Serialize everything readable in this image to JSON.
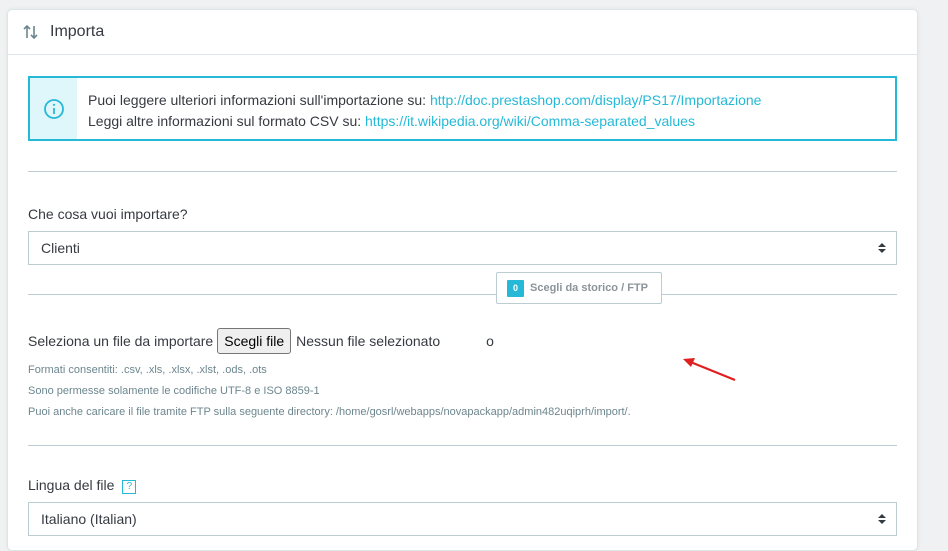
{
  "panel": {
    "title": "Importa"
  },
  "info": {
    "line1_text": "Puoi leggere ulteriori informazioni sull'importazione su: ",
    "line1_link": "http://doc.prestashop.com/display/PS17/Importazione",
    "line2_text": "Leggi altre informazioni sul formato CSV su: ",
    "line2_link": "https://it.wikipedia.org/wiki/Comma-separated_values"
  },
  "entity": {
    "label": "Che cosa vuoi importare?",
    "selected": "Clienti"
  },
  "file": {
    "label": "Seleziona un file da importare",
    "choose_button": "Scegli file",
    "no_file": "Nessun file selezionato",
    "or": "o",
    "history_count": "0",
    "history_button": "Scegli da storico / FTP",
    "help_formats": "Formati consentiti: .csv, .xls, .xlsx, .xlst, .ods, .ots",
    "help_encoding": "Sono permesse solamente le codifiche UTF-8 e ISO 8859-1",
    "help_ftp": "Puoi anche caricare il file tramite FTP sulla seguente directory: /home/gosrl/webapps/novapackapp/admin482uqiprh/import/."
  },
  "language": {
    "label": "Lingua del file",
    "help_icon": "?",
    "selected": "Italiano (Italian)"
  },
  "colors": {
    "accent": "#25b9d7",
    "annotation_arrow": "#e02020"
  }
}
